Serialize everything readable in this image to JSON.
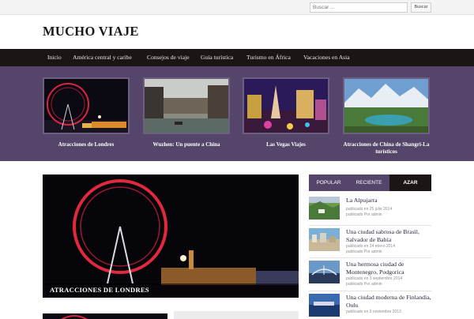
{
  "search": {
    "placeholder": "Buscar ...",
    "button": "Buscar"
  },
  "site": {
    "title": "MUCHO VIAJE"
  },
  "nav": {
    "items": [
      {
        "label": "Inicio"
      },
      {
        "label": "América central y caribe"
      },
      {
        "label": "Consejos de viaje"
      },
      {
        "label": "Guía turística"
      },
      {
        "label": "Turismo en África"
      },
      {
        "label": "Vacaciones en Asia"
      }
    ]
  },
  "featured": [
    {
      "title": "Atracciones de Londres"
    },
    {
      "title": "Wuzhen: Un puente a China"
    },
    {
      "title": "Las Vegas Viajes"
    },
    {
      "title": "Atracciones de China de Shangri-La turísticos"
    }
  ],
  "main_article": {
    "caption": "ATRACCIONES DE LONDRES"
  },
  "sidebar": {
    "tabs": [
      {
        "label": "POPULAR"
      },
      {
        "label": "RECIENTE"
      },
      {
        "label": "AZAR"
      }
    ],
    "active_tab": "AZAR",
    "items": [
      {
        "title": "La Alpujarra",
        "date": "publicado en 25 julio 2014",
        "author": "publicado Por admin"
      },
      {
        "title": "Una ciudad sabrosa de Brasil, Salvador de Bahía",
        "date": "publicado en 24 enero 2014",
        "author": "publicado Por admin"
      },
      {
        "title": "Una hermosa ciudad de Montenegro, Podgorica",
        "date": "publicado en 3 septiembre 2014",
        "author": "publicado Por admin"
      },
      {
        "title": "Una ciudad moderna de Finlandia, Oulu",
        "date": "publicado en 9 noviembre 2013",
        "author": ""
      }
    ]
  },
  "colors": {
    "nav_bg": "#1b1516",
    "band_bg": "#55456a",
    "accent": "#55456a",
    "text_dark": "#2b2440"
  }
}
